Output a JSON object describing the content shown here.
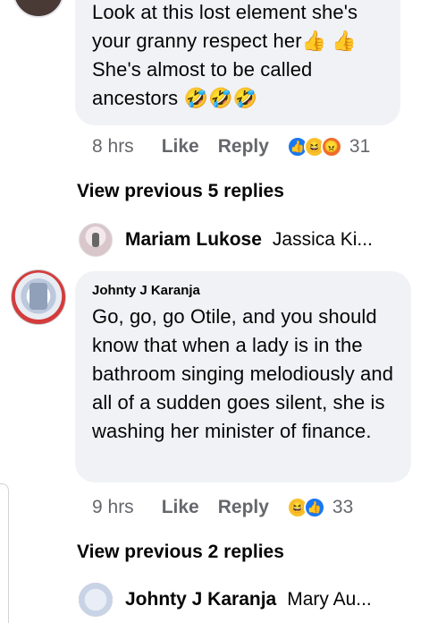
{
  "comment1": {
    "text": "Look at this lost element she's your granny respect her👍 👍 She's almost to be called ancestors 🤣🤣🤣",
    "time": "8 hrs",
    "like_label": "Like",
    "reply_label": "Reply",
    "reactions": [
      "like",
      "haha",
      "angry"
    ],
    "reaction_count": "31"
  },
  "replies1": {
    "view_previous": "View previous 5 replies",
    "latest": {
      "name": "Mariam Lukose",
      "snippet": "Jassica Ki..."
    }
  },
  "comment2": {
    "author": "Johnty J Karanja",
    "text": "Go, go, go Otile, and you should know that when a lady is in the bathroom singing melodiously and all of a sudden goes silent, she is washing her minister of finance.",
    "time": "9 hrs",
    "like_label": "Like",
    "reply_label": "Reply",
    "reactions": [
      "haha",
      "like"
    ],
    "reaction_count": "33"
  },
  "replies2": {
    "view_previous": "View previous 2 replies",
    "latest": {
      "name": "Johnty J Karanja",
      "snippet": "Mary Au..."
    }
  },
  "colors": {
    "bubble": "#f0f2f5",
    "meta_text": "#65676b",
    "like_blue": "#1877f2"
  }
}
